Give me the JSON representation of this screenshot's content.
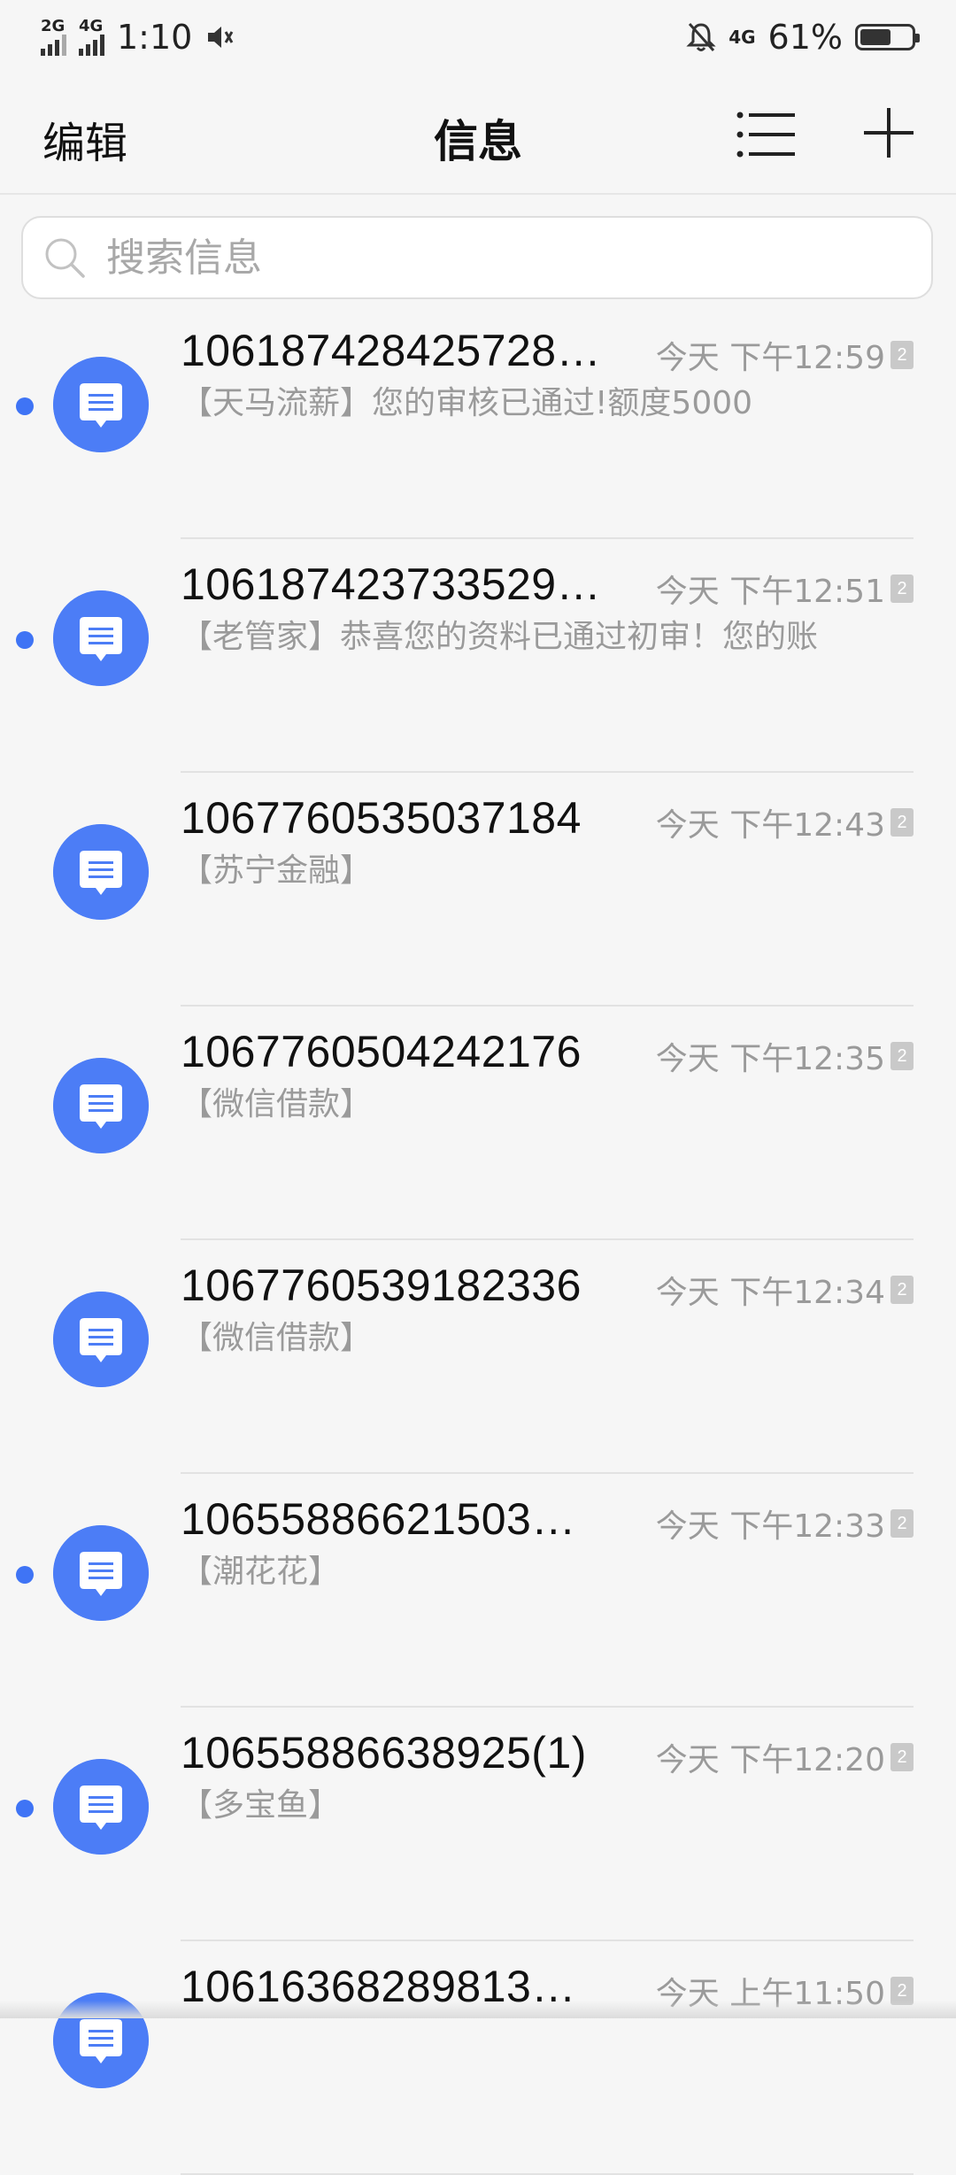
{
  "status_bar": {
    "signal1": "2G",
    "signal2": "4G",
    "time": "1:10",
    "network_right": "4G",
    "battery": "61%"
  },
  "header": {
    "edit_label": "编辑",
    "title": "信息"
  },
  "search": {
    "placeholder": "搜索信息"
  },
  "messages": [
    {
      "sender": "106187428425728…",
      "time": "今天 下午12:59",
      "sim": "2",
      "preview": "【天马流薪】您的审核已通过!额度5000",
      "unread": true
    },
    {
      "sender": "106187423733529…",
      "time": "今天 下午12:51",
      "sim": "2",
      "preview": "【老管家】恭喜您的资料已通过初审！您的账",
      "unread": true
    },
    {
      "sender": "1067760535037184",
      "time": "今天 下午12:43",
      "sim": "2",
      "preview": "【苏宁金融】",
      "unread": false
    },
    {
      "sender": "1067760504242176",
      "time": "今天 下午12:35",
      "sim": "2",
      "preview": "【微信借款】",
      "unread": false
    },
    {
      "sender": "1067760539182336",
      "time": "今天 下午12:34",
      "sim": "2",
      "preview": "【微信借款】",
      "unread": false
    },
    {
      "sender": "10655886621503…",
      "time": "今天 下午12:33",
      "sim": "2",
      "preview": "【潮花花】",
      "unread": true
    },
    {
      "sender": "10655886638925(1)",
      "time": "今天 下午12:20",
      "sim": "2",
      "preview": "【多宝鱼】",
      "unread": true
    },
    {
      "sender": "10616368289813…",
      "time": "今天 上午11:50",
      "sim": "2",
      "preview": "",
      "unread": false
    }
  ],
  "colors": {
    "accent": "#4c7df6",
    "unread_dot": "#3f74f5"
  },
  "icons": {
    "avatar": "message-bubble-icon",
    "menu": "list-menu-icon",
    "add": "plus-icon",
    "search": "search-icon"
  }
}
